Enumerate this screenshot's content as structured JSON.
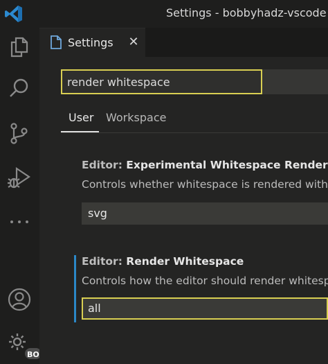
{
  "window": {
    "title": "Settings - bobbyhadz-vscode - b"
  },
  "activity_bar": {
    "items": [
      {
        "name": "explorer",
        "icon": "files-icon"
      },
      {
        "name": "search",
        "icon": "search-icon"
      },
      {
        "name": "source-control",
        "icon": "source-control-icon"
      },
      {
        "name": "run-debug",
        "icon": "run-debug-icon"
      },
      {
        "name": "more",
        "icon": "ellipsis-icon"
      }
    ],
    "accounts_icon": "account-icon",
    "manage_icon": "gear-icon",
    "manage_badge": "BO"
  },
  "tab": {
    "label": "Settings",
    "close_glyph": "✕"
  },
  "search": {
    "value": "render whitespace"
  },
  "scope_tabs": {
    "user": "User",
    "workspace": "Workspace"
  },
  "settings": [
    {
      "category": "Editor: ",
      "name": "Experimental Whitespace Rendering",
      "description": "Controls whether whitespace is rendered with a",
      "value": "svg"
    },
    {
      "category": "Editor: ",
      "name": "Render Whitespace",
      "description": "Controls how the editor should render whitespa",
      "value": "all"
    }
  ],
  "colors": {
    "accent_focus": "#d9cf52",
    "modified_indicator": "#2b88c7",
    "vscode_blue": "#2c8ad0"
  }
}
